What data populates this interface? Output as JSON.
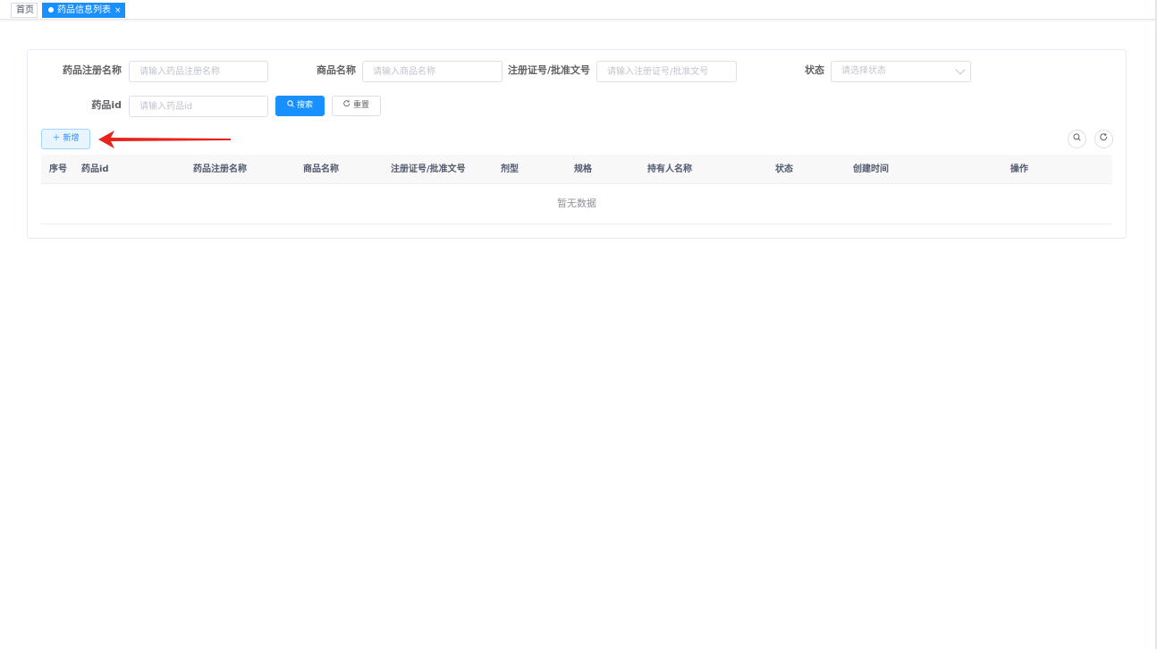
{
  "tabs": [
    {
      "label": "首页"
    },
    {
      "label": "药品信息列表",
      "close": "×"
    }
  ],
  "search": {
    "reg_name_label": "药品注册名称",
    "reg_name_placeholder": "请输入药品注册名称",
    "product_name_label": "商品名称",
    "product_name_placeholder": "请输入商品名称",
    "license_label": "注册证号/批准文号",
    "license_placeholder": "请输入注册证号/批准文号",
    "status_label": "状态",
    "status_placeholder": "请选择状态",
    "drug_id_label": "药品id",
    "drug_id_placeholder": "请输入药品id",
    "search_button": "搜索",
    "reset_button": "重置"
  },
  "toolbar": {
    "add_button": "新增",
    "search_toggle_icon": "search-icon",
    "refresh_icon": "refresh-icon"
  },
  "table": {
    "columns": [
      "序号",
      "药品id",
      "药品注册名称",
      "商品名称",
      "注册证号/批准文号",
      "剂型",
      "规格",
      "持有人名称",
      "状态",
      "创建时间",
      "操作"
    ],
    "empty_text": "暂无数据"
  },
  "colors": {
    "primary": "#1890ff",
    "arrow": "#e8231b"
  }
}
